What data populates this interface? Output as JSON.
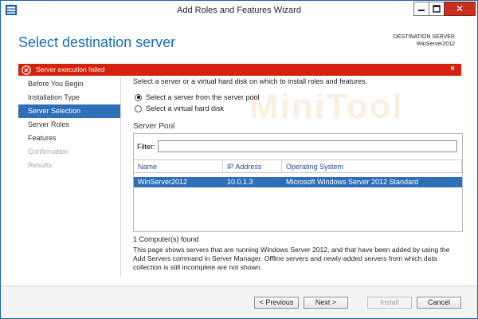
{
  "window": {
    "title": "Add Roles and Features Wizard",
    "close_glyph": "✕"
  },
  "header": {
    "page_title": "Select destination server",
    "destination_label": "DESTINATION SERVER",
    "destination_value": "WinServer2012"
  },
  "error": {
    "message": "Server execution failed",
    "close_glyph": "×",
    "color": "#d3220d"
  },
  "nav": {
    "items": [
      {
        "label": "Before You Begin"
      },
      {
        "label": "Installation Type"
      },
      {
        "label": "Server Selection"
      },
      {
        "label": "Server Roles"
      },
      {
        "label": "Features"
      },
      {
        "label": "Confirmation"
      },
      {
        "label": "Results"
      }
    ],
    "active_index": 2,
    "disabled_from_index": 5
  },
  "main": {
    "instruction": "Select a server or a virtual hard disk on which to install roles and features.",
    "options": {
      "server_pool": "Select a server from the server pool",
      "vhd": "Select a virtual hard disk"
    },
    "selected_option": "server_pool",
    "section_title": "Server Pool",
    "filter": {
      "label": "Filter:",
      "value": ""
    },
    "columns": [
      "Name",
      "IP Address",
      "Operating System"
    ],
    "rows": [
      [
        "WinServer2012",
        "10.0.1.3",
        "Microsoft Windows Server 2012 Standard"
      ]
    ],
    "count": "1 Computer(s) found",
    "description": "This page shows servers that are running Windows Server 2012, and that have been added by using the Add Servers command in Server Manager. Offline servers and newly-added servers from which data collection is still incomplete are not shown."
  },
  "watermark": "MiniTool",
  "footer": {
    "previous": "< Previous",
    "next": "Next >",
    "install": "Install",
    "cancel": "Cancel"
  },
  "colors": {
    "accent": "#2f6fb8",
    "title_blue": "#1a6fb5",
    "close_button": "#c7311e"
  }
}
